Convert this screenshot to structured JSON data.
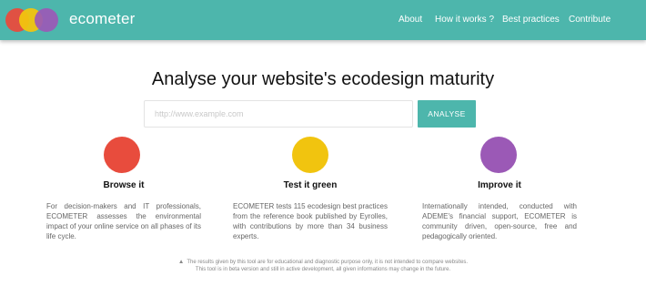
{
  "header": {
    "brand": "ecometer",
    "nav": [
      "About",
      "How it works ?",
      "Best practices",
      "Contribute"
    ]
  },
  "hero": {
    "title": "Analyse your website's ecodesign maturity",
    "search_placeholder": "http://www.example.com",
    "search_value": "",
    "analyse_label": "ANALYSE"
  },
  "features": [
    {
      "color": "#e84c3d",
      "title": "Browse it",
      "description": "For decision-makers and IT professionals, ECOMETER assesses the environmental impact of your online service on all phases of its life cycle."
    },
    {
      "color": "#f1c40f",
      "title": "Test it green",
      "description": "ECOMETER tests 115 ecodesign best practices from the reference book published by Eyrolles, with contributions by more than 34 business experts."
    },
    {
      "color": "#9b59b6",
      "title": "Improve it",
      "description": "Internationally intended, conducted with ADEME's financial support, ECOMETER is community driven, open-source, free and pedagogically oriented."
    }
  ],
  "disclaimer": {
    "icon": "warning-icon",
    "line1": "The results given by this tool are for educational and diagnostic purpose only, it is not intended to compare websites.",
    "line2": "This tool is in beta version and still in active development, all given informations may change in the future."
  },
  "colors": {
    "accent": "#4db6ac",
    "red": "#e84c3d",
    "yellow": "#f1c40f",
    "purple": "#9b59b6"
  }
}
